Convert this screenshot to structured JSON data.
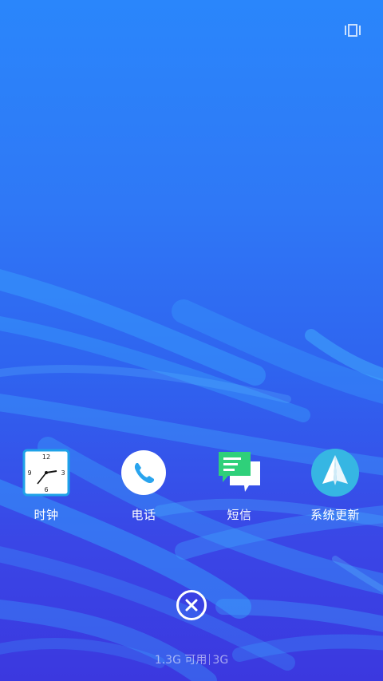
{
  "apps": [
    {
      "label": "时钟",
      "icon": "clock-icon"
    },
    {
      "label": "电话",
      "icon": "phone-icon"
    },
    {
      "label": "短信",
      "icon": "messages-icon"
    },
    {
      "label": "系统更新",
      "icon": "paper-plane-icon"
    }
  ],
  "clock_face": {
    "n12": "12",
    "n3": "3",
    "n6": "6",
    "n9": "9"
  },
  "memory": {
    "available": "1.3G 可用",
    "total": "3G"
  },
  "colors": {
    "accent": "#2f78f6",
    "bubble_green": "#2fd07a",
    "update_circle": "#36b6e3"
  },
  "top_right_icon": "multi-window-icon",
  "close_icon": "close-icon"
}
